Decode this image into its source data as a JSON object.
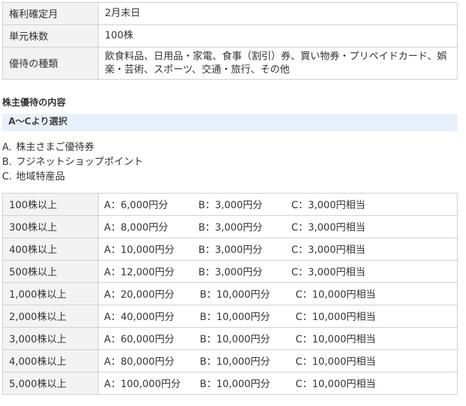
{
  "info_table": [
    {
      "label": "権利確定月",
      "value": "2月末日"
    },
    {
      "label": "単元株数",
      "value": "100株"
    },
    {
      "label": "優待の種類",
      "value": "飲食料品、日用品・家電、食事（割引）券、買い物券・プリペイドカード、娯楽・芸術、スポーツ、交通・旅行、その他"
    }
  ],
  "section_title": "株主優待の内容",
  "select_bar": "A～Cより選択",
  "options": [
    {
      "letter": "A.",
      "label": "株主さまご優待券"
    },
    {
      "letter": "B.",
      "label": "フジネットショップポイント"
    },
    {
      "letter": "C.",
      "label": "地域特産品"
    }
  ],
  "tiers": [
    {
      "shares": "100株以上",
      "a": "A：6,000円分",
      "b": "B：3,000円分",
      "c": "C：3,000円相当"
    },
    {
      "shares": "300株以上",
      "a": "A：8,000円分",
      "b": "B：3,000円分",
      "c": "C：3,000円相当"
    },
    {
      "shares": "400株以上",
      "a": "A：10,000円分",
      "b": "B：3,000円分",
      "c": "C：3,000円相当"
    },
    {
      "shares": "500株以上",
      "a": "A：12,000円分",
      "b": "B：3,000円分",
      "c": "C：3,000円相当"
    },
    {
      "shares": "1,000株以上",
      "a": "A：20,000円分",
      "b": "B：10,000円分",
      "c": "C：10,000円相当"
    },
    {
      "shares": "2,000株以上",
      "a": "A：40,000円分",
      "b": "B：10,000円分",
      "c": "C：10,000円相当"
    },
    {
      "shares": "3,000株以上",
      "a": "A：60,000円分",
      "b": "B：10,000円分",
      "c": "C：10,000円相当"
    },
    {
      "shares": "4,000株以上",
      "a": "A：80,000円分",
      "b": "B：10,000円分",
      "c": "C：10,000円相当"
    },
    {
      "shares": "5,000株以上",
      "a": "A：100,000円分",
      "b": "B：10,000円分",
      "c": "C：10,000円相当"
    }
  ],
  "colors": {
    "header_cell_bg": "#f3f3f3",
    "select_bar_bg": "#e8f1fb",
    "border": "#cfcfcf",
    "text": "#333333"
  }
}
